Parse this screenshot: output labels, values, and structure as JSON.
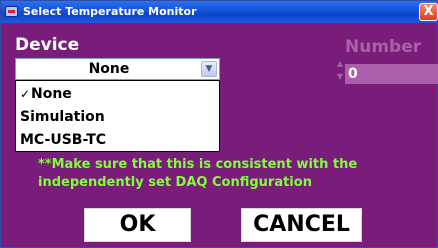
{
  "window": {
    "title": "Select Temperature Monitor",
    "close_label": "X"
  },
  "device": {
    "label": "Device",
    "selected": "None",
    "options": [
      {
        "label": "None",
        "checked": true,
        "check_mark": "✓"
      },
      {
        "label": "Simulation",
        "checked": false,
        "check_mark": ""
      },
      {
        "label": "MC-USB-TC",
        "checked": false,
        "check_mark": ""
      }
    ],
    "dropdown_arrow": "▼"
  },
  "number": {
    "label": "Number",
    "value": "0",
    "up_arrow": "▲",
    "down_arrow": "▼"
  },
  "warning": {
    "line1": "**Make sure that this is consistent with the",
    "line2": "independently set DAQ Configuration"
  },
  "buttons": {
    "ok": "OK",
    "cancel": "CANCEL"
  },
  "colors": {
    "background": "#7a1d7a",
    "warning_text": "#7fff3a",
    "disabled": "#a95fa9",
    "titlebar": "#1452d8"
  }
}
